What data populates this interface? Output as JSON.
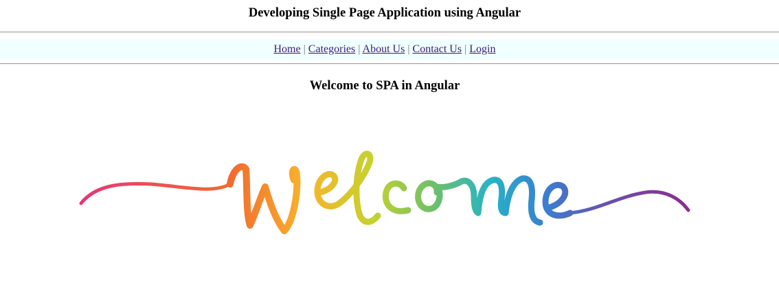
{
  "header": {
    "title": "Developing Single Page Application using Angular"
  },
  "nav": {
    "items": [
      {
        "label": "Home"
      },
      {
        "label": "Categories"
      },
      {
        "label": "About Us"
      },
      {
        "label": "Contact Us"
      },
      {
        "label": "Login"
      }
    ],
    "separator": "|",
    "background": "#f0ffff",
    "link_color": "#3a1c7a"
  },
  "main": {
    "heading": "Welcome to SPA in Angular",
    "image": {
      "subject": "welcome-lettering",
      "lettering": "Welcome",
      "colors": [
        "#e8337a",
        "#f26a2f",
        "#f9b32b",
        "#c5d22e",
        "#6cc06a",
        "#27b3c6",
        "#3a7fd0",
        "#6a4fb0",
        "#8e2a8a"
      ]
    }
  }
}
